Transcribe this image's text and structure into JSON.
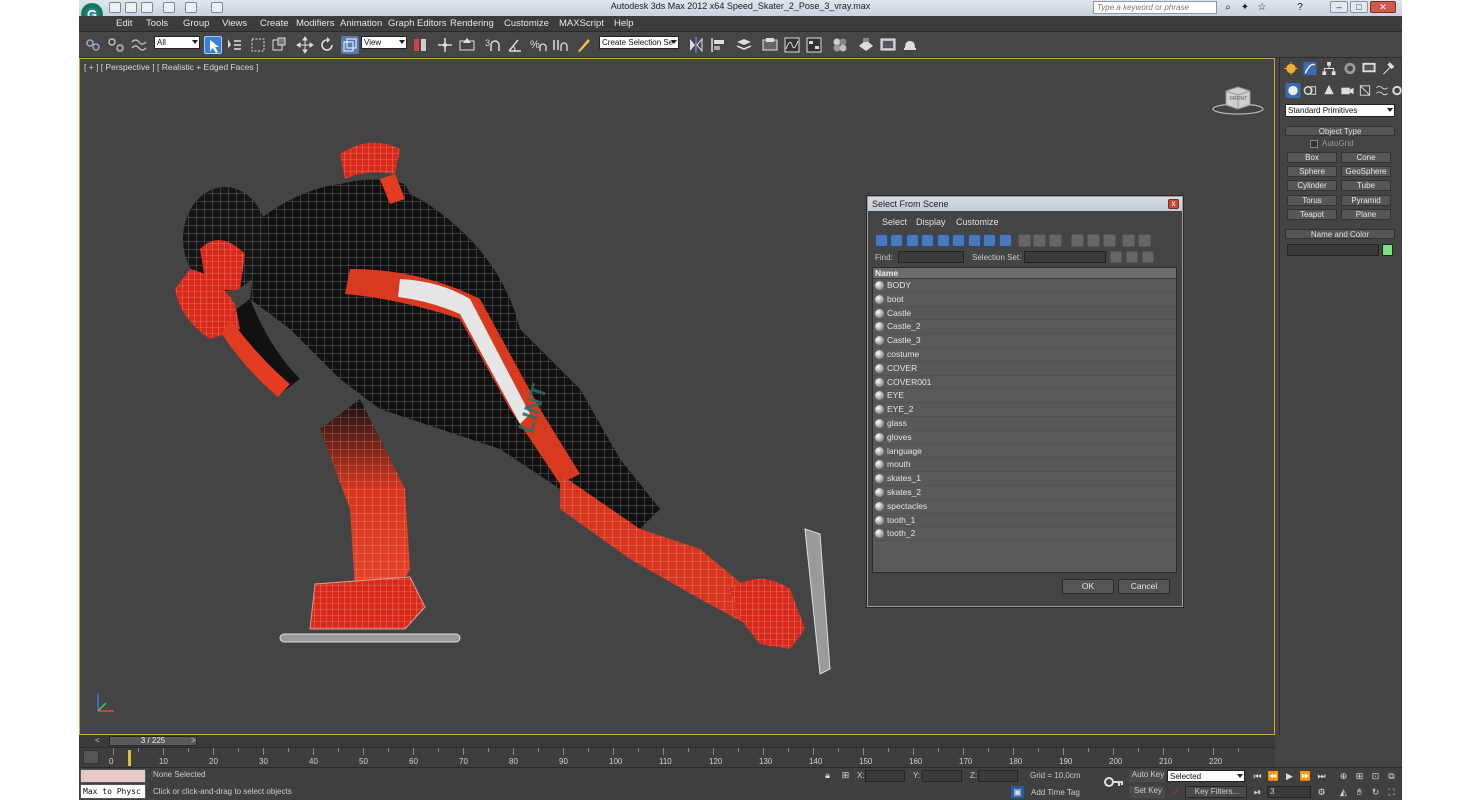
{
  "window": {
    "title": "Autodesk 3ds Max  2012 x64      Speed_Skater_2_Pose_3_vray.max",
    "search_placeholder": "Type a keyword or phrase",
    "logo_glyph": "G"
  },
  "menu": [
    "Edit",
    "Tools",
    "Group",
    "Views",
    "Create",
    "Modifiers",
    "Animation",
    "Graph Editors",
    "Rendering",
    "Customize",
    "MAXScript",
    "Help"
  ],
  "toolbar": {
    "selection_filter": "All",
    "ref_coord": "View",
    "named_selection": "Create Selection Se"
  },
  "viewport": {
    "label": "[ + ] [ Perspective ] [ Realistic + Edged Faces ]",
    "viewcube_label": "FRONT"
  },
  "dialog": {
    "title": "Select From Scene",
    "close": "x",
    "menus": [
      "Select",
      "Display",
      "Customize"
    ],
    "find_label": "Find:",
    "selection_set_label": "Selection Set:",
    "column_name": "Name",
    "items": [
      "BODY",
      "boot",
      "Castle",
      "Castle_2",
      "Castle_3",
      "costume",
      "COVER",
      "COVER001",
      "EYE",
      "EYE_2",
      "glass",
      "gloves",
      "language",
      "mouth",
      "skates_1",
      "skates_2",
      "spectacles",
      "tooth_1",
      "tooth_2"
    ],
    "ok": "OK",
    "cancel": "Cancel"
  },
  "command_panel": {
    "category": "Standard Primitives",
    "object_type_title": "Object Type",
    "autogrid": "AutoGrid",
    "buttons": [
      "Box",
      "Cone",
      "Sphere",
      "GeoSphere",
      "Cylinder",
      "Tube",
      "Torus",
      "Pyramid",
      "Teapot",
      "Plane"
    ],
    "name_color_title": "Name and Color",
    "color": "#7ee07e"
  },
  "timeline": {
    "frame_display": "3 / 225",
    "prev": "<",
    "next": ">",
    "ticks": [
      0,
      10,
      20,
      30,
      40,
      50,
      60,
      70,
      80,
      90,
      100,
      110,
      120,
      130,
      140,
      150,
      160,
      170,
      180,
      190,
      200,
      210,
      220
    ]
  },
  "status": {
    "maxscript": "Max to Physc",
    "selection": "None Selected",
    "prompt": "Click or click-and-drag to select objects",
    "x_label": "X:",
    "y_label": "Y:",
    "z_label": "Z:",
    "grid": "Grid = 10,0cm",
    "add_time_tag": "Add Time Tag",
    "auto_key": "Auto Key",
    "set_key": "Set Key",
    "key_mode": "Selected",
    "key_filters": "Key Filters...",
    "current_frame": "3"
  }
}
